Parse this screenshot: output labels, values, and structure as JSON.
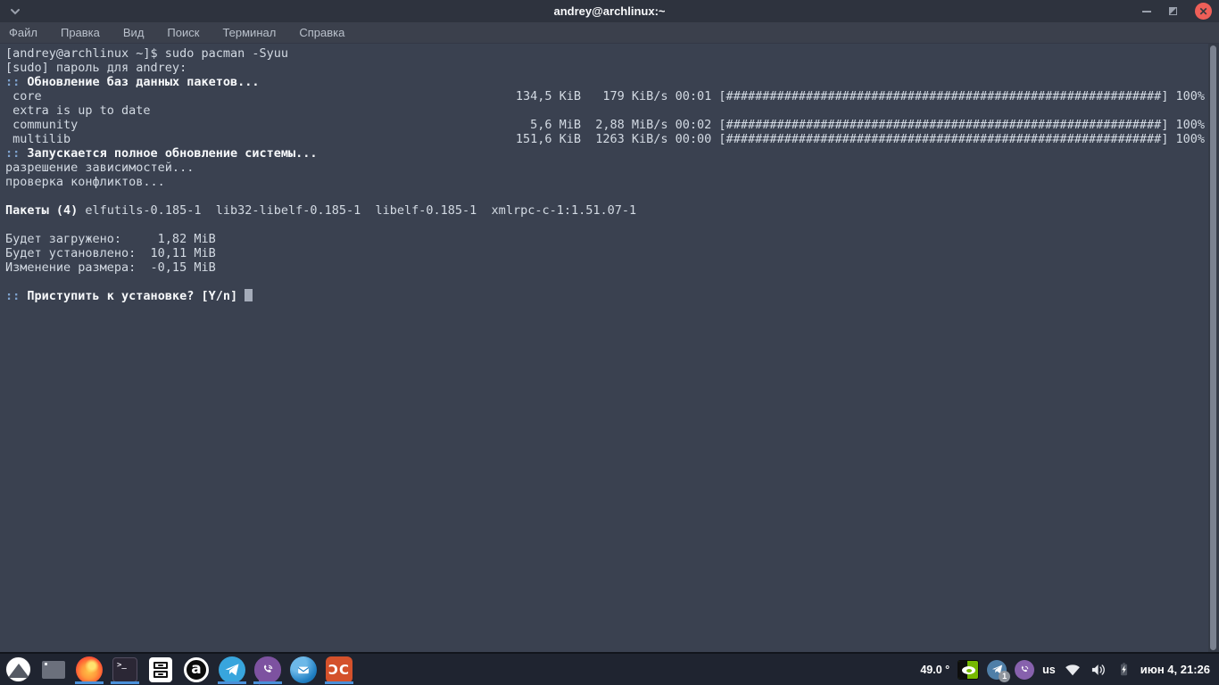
{
  "window": {
    "title": "andrey@archlinux:~",
    "close_glyph": "✕"
  },
  "menubar": {
    "items": [
      "Файл",
      "Правка",
      "Вид",
      "Поиск",
      "Терминал",
      "Справка"
    ]
  },
  "terminal": {
    "lines": [
      {
        "segments": [
          {
            "t": "[andrey@archlinux ~]$ sudo pacman -Syuu",
            "s": "n"
          }
        ]
      },
      {
        "segments": [
          {
            "t": "[sudo] пароль для andrey:",
            "s": "n"
          }
        ]
      },
      {
        "segments": [
          {
            "t": ":: ",
            "s": "p"
          },
          {
            "t": "Обновление баз данных пакетов...",
            "s": "b"
          }
        ]
      },
      {
        "left": [
          {
            "t": " core",
            "s": "n"
          }
        ],
        "right": [
          {
            "t": "134,5 KiB   179 KiB/s 00:01 [############################################################] 100%",
            "s": "n"
          }
        ]
      },
      {
        "segments": [
          {
            "t": " extra is up to date",
            "s": "n"
          }
        ]
      },
      {
        "left": [
          {
            "t": " community",
            "s": "n"
          }
        ],
        "right": [
          {
            "t": "  5,6 MiB  2,88 MiB/s 00:02 [############################################################] 100%",
            "s": "n"
          }
        ]
      },
      {
        "left": [
          {
            "t": " multilib",
            "s": "n"
          }
        ],
        "right": [
          {
            "t": "151,6 KiB  1263 KiB/s 00:00 [############################################################] 100%",
            "s": "n"
          }
        ]
      },
      {
        "segments": [
          {
            "t": ":: ",
            "s": "p"
          },
          {
            "t": "Запускается полное обновление системы...",
            "s": "b"
          }
        ]
      },
      {
        "segments": [
          {
            "t": "разрешение зависимостей...",
            "s": "n"
          }
        ]
      },
      {
        "segments": [
          {
            "t": "проверка конфликтов...",
            "s": "n"
          }
        ]
      },
      {
        "blank": true
      },
      {
        "segments": [
          {
            "t": "Пакеты (4)",
            "s": "b"
          },
          {
            "t": " elfutils-0.185-1  lib32-libelf-0.185-1  libelf-0.185-1  xmlrpc-c-1:1.51.07-1",
            "s": "n"
          }
        ]
      },
      {
        "blank": true
      },
      {
        "segments": [
          {
            "t": "Будет загружено:     1,82 MiB",
            "s": "n"
          }
        ]
      },
      {
        "segments": [
          {
            "t": "Будет установлено:  10,11 MiB",
            "s": "n"
          }
        ]
      },
      {
        "segments": [
          {
            "t": "Изменение размера:  -0,15 MiB",
            "s": "n"
          }
        ]
      },
      {
        "blank": true
      },
      {
        "segments": [
          {
            "t": ":: ",
            "s": "p"
          },
          {
            "t": "Приступить к установке? [Y/n] ",
            "s": "b"
          },
          {
            "t": "",
            "s": "c"
          }
        ]
      }
    ]
  },
  "taskbar": {
    "launchers": [
      {
        "id": "app-menu",
        "running": false
      },
      {
        "id": "window-list",
        "running": false
      },
      {
        "id": "firefox",
        "running": true
      },
      {
        "id": "terminal",
        "running": true
      },
      {
        "id": "file-manager",
        "running": false
      },
      {
        "id": "a-app",
        "running": false
      },
      {
        "id": "telegram",
        "running": true
      },
      {
        "id": "viber",
        "running": true
      },
      {
        "id": "thunderbird",
        "running": false
      },
      {
        "id": "dcpp",
        "running": true
      }
    ],
    "terminal_glyph": ">_",
    "a_glyph": "a",
    "dc_glyph": "ƆC",
    "tray": {
      "temperature": "49.0 °",
      "telegram_badge": "1",
      "keyboard_layout": "us",
      "clock": "июн 4, 21:26"
    }
  },
  "colors": {
    "accent_running": "#4a90d9",
    "close_button": "#ee5f58",
    "terminal_bg": "#3a4150",
    "taskbar_bg": "#1f2430",
    "nvidia_green": "#76b900",
    "telegram_blue": "#38a5dd",
    "viber_purple": "#7d52a0",
    "dc_orange": "#d4512b"
  }
}
